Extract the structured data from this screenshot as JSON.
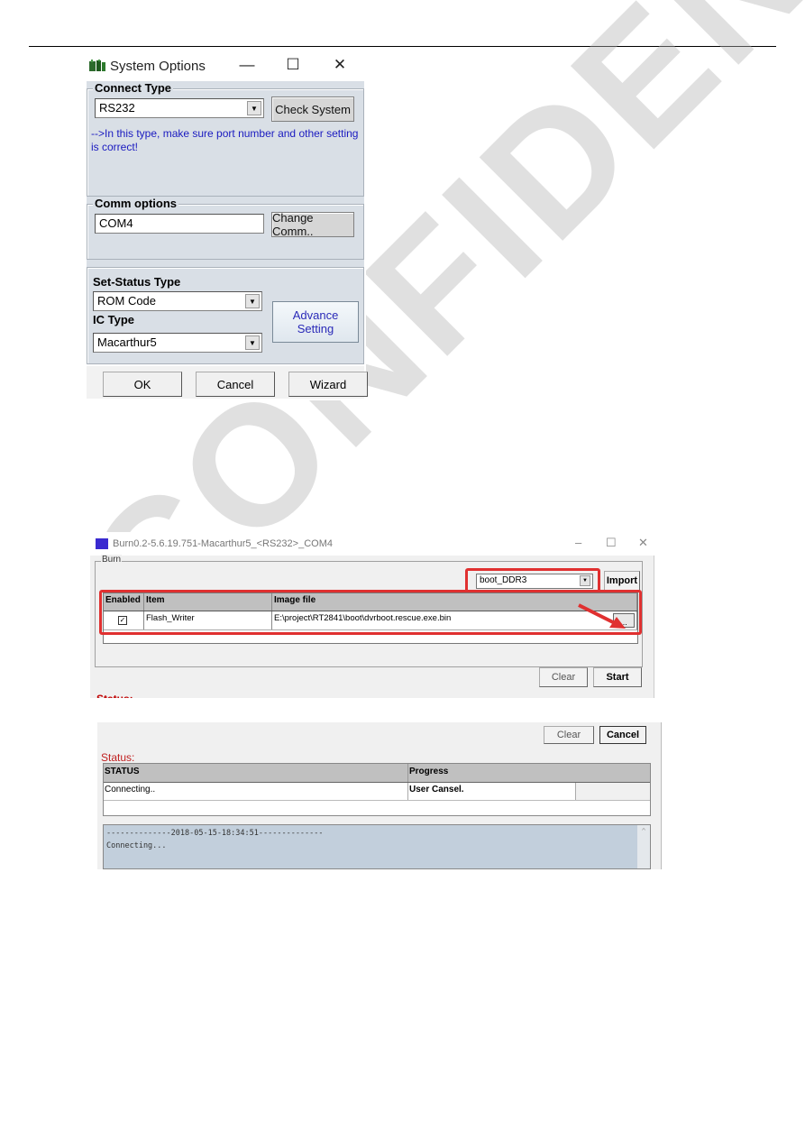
{
  "system_options": {
    "title": "System Options",
    "icon": "board-chip-icon",
    "window_controls": {
      "minimize": "—",
      "maximize": "☐",
      "close": "✕"
    },
    "connect_type": {
      "label": "Connect Type",
      "selected": "RS232",
      "check_button": "Check System",
      "info": "-->In this type, make sure port number and other setting is correct!"
    },
    "comm_options": {
      "label": "Comm options",
      "value": "COM4",
      "change_button": "Change Comm.."
    },
    "set_status": {
      "label": "Set-Status Type",
      "selected": "ROM Code",
      "ic_label": "IC Type",
      "ic_selected": "Macarthur5",
      "advance_line1": "Advance",
      "advance_line2": "Setting"
    },
    "footer": {
      "ok": "OK",
      "cancel": "Cancel",
      "wizard": "Wizard"
    },
    "colors": {
      "panel": "#d9dfe6",
      "info_text": "#1a1ac0",
      "advance_text": "#2a2ab8"
    }
  },
  "burn_window": {
    "title": "Burn0.2-5.6.19.751-Macarthur5_<RS232>_COM4",
    "icon": "burn-app-icon",
    "window_controls": {
      "minimize": "–",
      "maximize": "☐",
      "close": "✕"
    },
    "group_label": "Burn",
    "profile_selected": "boot_DDR3",
    "import_button": "Import",
    "table": {
      "headers": [
        "Enabled",
        "Item",
        "Image file"
      ],
      "rows": [
        {
          "enabled": true,
          "check_glyph": "✓",
          "item": "Flash_Writer",
          "image_file": "E:\\project\\RT2841\\boot\\dvrboot.rescue.exe.bin",
          "browse": "..."
        }
      ]
    },
    "clear_button": "Clear",
    "start_button": "Start",
    "status_peek": "Status:",
    "highlight_color": "#e03030"
  },
  "status_window": {
    "clear_button": "Clear",
    "cancel_button": "Cancel",
    "status_label": "Status:",
    "table": {
      "headers": [
        "STATUS",
        "Progress"
      ],
      "rows": [
        {
          "status": "Connecting..",
          "progress": "User Cansel."
        }
      ]
    },
    "log": {
      "lines": [
        "--------------2018-05-15-18:34:51--------------",
        "Connecting..."
      ]
    },
    "scroll_up": "^"
  },
  "watermark": "CONFIDENTIAL"
}
